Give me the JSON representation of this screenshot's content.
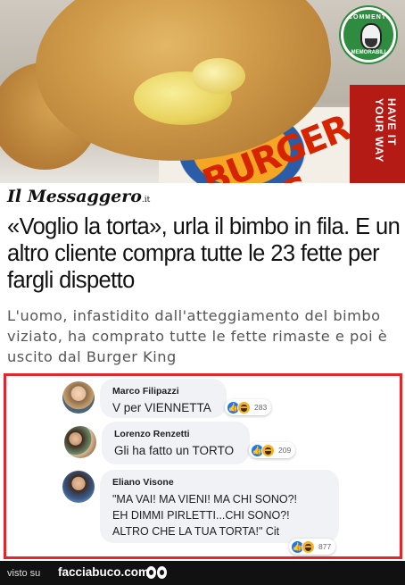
{
  "image": {
    "badge_top": "COMMENTI",
    "badge_bottom": "MEMORABILI",
    "box_brand": "BURGER KING",
    "box_side": "HAVE IT YOUR WAY"
  },
  "article": {
    "masthead": "Il Messaggero",
    "masthead_suffix": ".it",
    "headline": "«Voglio la torta», urla il bimbo in fila. E un altro cliente compra tutte le 23 fette per fargli dispetto",
    "subheadline": "L'uomo, infastidito dall'atteggiamento del bimbo viziato, ha comprato tutte le fette rimaste e poi è uscito dal Burger King"
  },
  "comments": [
    {
      "author": "Marco Filipazzi",
      "text": "V per VIENNETTA",
      "reaction_count": "283"
    },
    {
      "author": "Lorenzo Renzetti",
      "text": "Gli ha fatto un TORTO",
      "reaction_count": "209"
    },
    {
      "author": "Eliano Visone",
      "text": "\"MA VAI! MA VIENI! MA CHI SONO?!\nEH DIMMI PIRLETTI...CHI SONO?!\nALTRO CHE LA TUA TORTA!\" Cit",
      "reaction_count": "877"
    }
  ],
  "footer": {
    "visto_su": "visto su",
    "site": "facciabuco.com"
  },
  "colors": {
    "frame": "#e2262b",
    "bubble": "#f0f2f5",
    "like": "#1877f2",
    "haha": "#f7b125",
    "footer_bg": "#111111"
  }
}
